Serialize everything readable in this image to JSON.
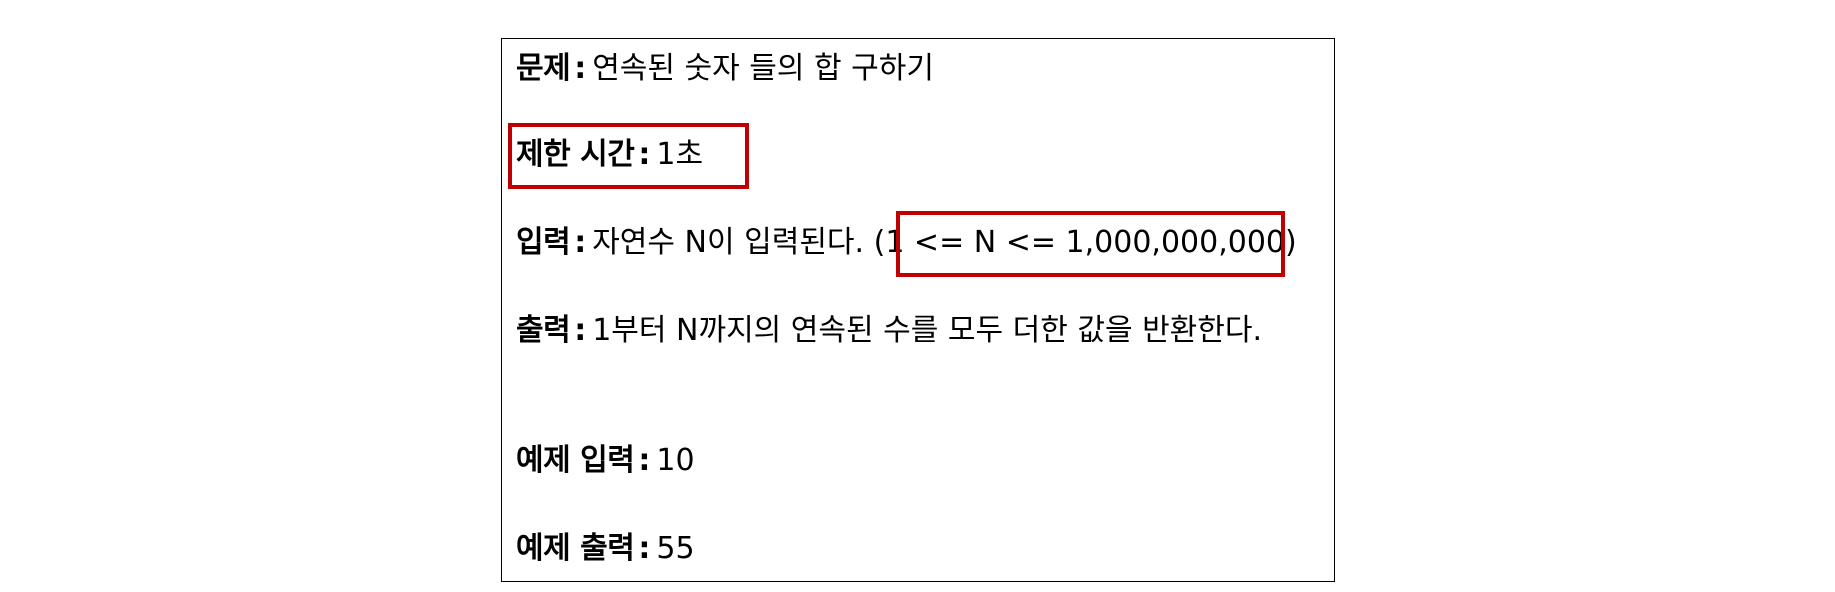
{
  "problem": {
    "title_label": "문제",
    "title_value": "연속된 숫자 들의 합 구하기",
    "time_label": "제한 시간",
    "time_value": "1초",
    "input_label": "입력",
    "input_value": "자연수 N이 입력된다.",
    "input_range": "(1 <= N <= 1,000,000,000)",
    "output_label": "출력",
    "output_value": "1부터 N까지의 연속된 수를 모두 더한 값을 반환한다.",
    "example_input_label": "예제 입력",
    "example_input_value": "10",
    "example_output_label": "예제 출력",
    "example_output_value": "55",
    "separator": ":"
  },
  "colors": {
    "highlight": "#c00000",
    "border": "#000000",
    "text": "#000000",
    "background": "#ffffff"
  }
}
